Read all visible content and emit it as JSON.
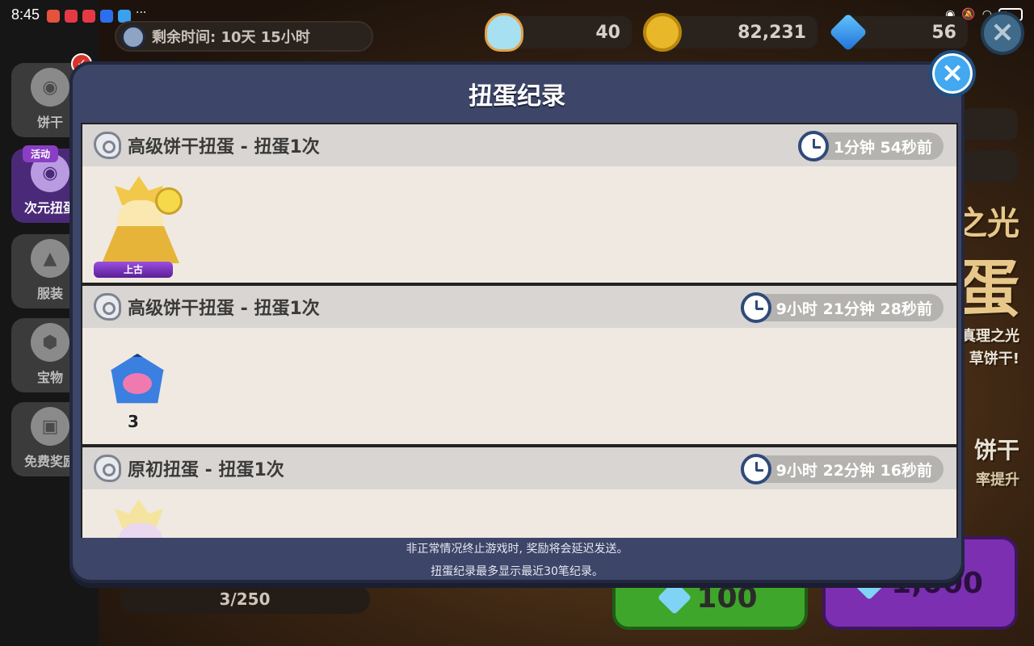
{
  "status_bar": {
    "time": "8:45",
    "more": "···"
  },
  "top_bar": {
    "timer_label": "剩余时间: 10天 15小时",
    "potion_count": "40",
    "coin_count": "82,231",
    "gem_count": "56"
  },
  "side_rail": {
    "items": [
      {
        "label": "饼干"
      },
      {
        "label": "次元扭蛋",
        "tag": "活动"
      },
      {
        "label": "服装"
      },
      {
        "label": "宝物"
      },
      {
        "label": "免费奖励"
      }
    ]
  },
  "background": {
    "progress": "3/250",
    "btn_single": "100",
    "btn_multi": "1,000",
    "side_text_1": "之光",
    "side_text_2": "蛋",
    "side_text_3": "真理之光",
    "side_text_4": "草饼干!",
    "side_text_5": "饼干",
    "side_text_6": "率提升"
  },
  "modal": {
    "title": "扭蛋纪录",
    "close_label": "×",
    "entries": [
      {
        "name": "高级饼干扭蛋 - 扭蛋1次",
        "time_ago": "1分钟 54秒前",
        "reward_type": "cookie",
        "rarity": "上古"
      },
      {
        "name": "高级饼干扭蛋 - 扭蛋1次",
        "time_ago": "9小时 21分钟 28秒前",
        "reward_type": "treasure",
        "count": "3"
      },
      {
        "name": "原初扭蛋 - 扭蛋1次",
        "time_ago": "9小时 22分钟 16秒前",
        "reward_type": "cookie"
      }
    ],
    "footer_line_1": "非正常情况终止游戏时, 奖励将会延迟发送。",
    "footer_line_2": "扭蛋纪录最多显示最近30笔纪录。"
  }
}
